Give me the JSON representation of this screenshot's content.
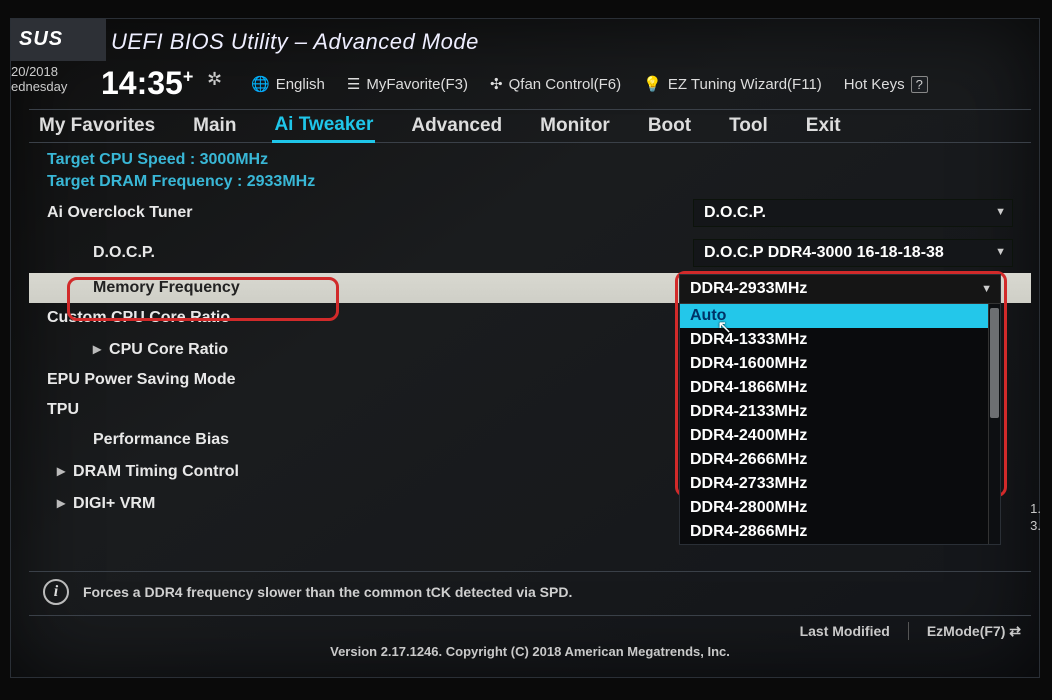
{
  "brand": "SUS",
  "title": "UEFI BIOS Utility – Advanced Mode",
  "date_line1": "20/2018",
  "date_line2": "ednesday",
  "time": "14:35",
  "utilbar": {
    "language": "English",
    "myfavorite": "MyFavorite(F3)",
    "qfan": "Qfan Control(F6)",
    "ez_tuning": "EZ Tuning Wizard(F11)",
    "hotkeys_label": "Hot Keys",
    "hotkeys_key": "?"
  },
  "menu": {
    "items": [
      "My Favorites",
      "Main",
      "Ai Tweaker",
      "Advanced",
      "Monitor",
      "Boot",
      "Tool",
      "Exit"
    ],
    "active_index": 2
  },
  "info": {
    "cpu_speed": "Target CPU Speed : 3000MHz",
    "dram_freq": "Target DRAM Frequency : 2933MHz"
  },
  "rows": {
    "ai_overclock_label": "Ai Overclock Tuner",
    "ai_overclock_value": "D.O.C.P.",
    "docp_label": "D.O.C.P.",
    "docp_value": "D.O.C.P DDR4-3000 16-18-18-38",
    "memfreq_label": "Memory Frequency",
    "memfreq_value": "DDR4-2933MHz",
    "custom_ratio": "Custom CPU Core Ratio",
    "cpu_core_ratio": "CPU Core Ratio",
    "epu": "EPU Power Saving Mode",
    "tpu": "TPU",
    "perf_bias": "Performance Bias",
    "dram_timing": "DRAM Timing Control",
    "digi_vrm": "DIGI+ VRM"
  },
  "dropdown": {
    "header": "DDR4-2933MHz",
    "options": [
      "Auto",
      "DDR4-1333MHz",
      "DDR4-1600MHz",
      "DDR4-1866MHz",
      "DDR4-2133MHz",
      "DDR4-2400MHz",
      "DDR4-2666MHz",
      "DDR4-2733MHz",
      "DDR4-2800MHz",
      "DDR4-2866MHz"
    ],
    "hover_index": 0
  },
  "help_text": "Forces a DDR4 frequency slower than the common tCK detected via SPD.",
  "footer": {
    "last_modified": "Last Modified",
    "ezmode": "EzMode(F7)",
    "copyright": "Version 2.17.1246. Copyright (C) 2018 American Megatrends, Inc."
  },
  "side_numbers": [
    "1.",
    "3."
  ]
}
